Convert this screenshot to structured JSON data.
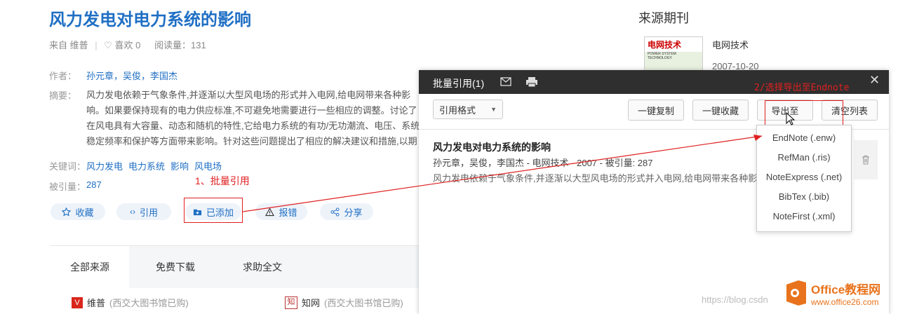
{
  "article": {
    "title": "风力发电对电力系统的影响",
    "source": "来自 维普",
    "likes": "♡ 喜欢 0",
    "reads": "阅读量：131",
    "authors_label": "作者：",
    "authors": "孙元章，吴俊，李国杰",
    "abstract_label": "摘要：",
    "abstract": "风力发电依赖于气象条件,并逐渐以大型风电场的形式并入电网,给电网带来各种影响。如果要保持现有的电力供应标准,不可避免地需要进行一些相应的调整。讨论了在风电具有大容量、动态和随机的特性,它给电力系统的有功/无功潮流、电压、系统稳定频率和保护等方面带来影响。针对这些问题提出了相应的解决建议和措施,以期更好",
    "keywords_label": "关键词：",
    "keywords": [
      "风力发电",
      "电力系统",
      "影响",
      "风电场"
    ],
    "citations_label": "被引量：",
    "citations": "287"
  },
  "actions": {
    "favorite": "收藏",
    "cite": "引用",
    "added": "已添加",
    "report": "报错",
    "share": "分享"
  },
  "annotations": {
    "step1": "1、批量引用",
    "step2": "2/选择导出至Endnote"
  },
  "tabs": [
    "全部来源",
    "免费下载",
    "求助全文"
  ],
  "sources": [
    {
      "name": "维普",
      "note": "(西交大图书馆已购)"
    },
    {
      "name": "知网",
      "note": "(西交大图书馆已购)"
    }
  ],
  "sidebar": {
    "title": "来源期刊",
    "journal_name": "电网技术",
    "journal_date": "2007-10-20",
    "cover_text": "电网技术",
    "cover_sub": "POWER SYSTEM TECHNOLOGY"
  },
  "modal": {
    "title": "批量引用(1)",
    "format_select": "引用格式",
    "btn_copy": "一键复制",
    "btn_collect": "一键收藏",
    "btn_export": "导出至",
    "btn_clear": "清空列表",
    "item_title": "风力发电对电力系统的影响",
    "item_meta": "孙元章，吴俊，李国杰 - 电网技术 - 2007 - 被引量: 287",
    "item_abstract": "风力发电依赖于气象条件,并逐渐以大型风电场的形式并入电网,给电网带来各种影响"
  },
  "export_menu": [
    "EndNote (.enw)",
    "RefMan (.ris)",
    "NoteExpress (.net)",
    "BibTex (.bib)",
    "NoteFirst (.xml)"
  ],
  "watermark": {
    "url_text": "https://blog.csdn",
    "brand": "Office教程网",
    "site": "www.office26.com"
  },
  "colors": {
    "link": "#1f6fc4",
    "annotation": "#e02020",
    "modal_header": "#2f2f2f",
    "brand_orange": "#e8731c"
  }
}
